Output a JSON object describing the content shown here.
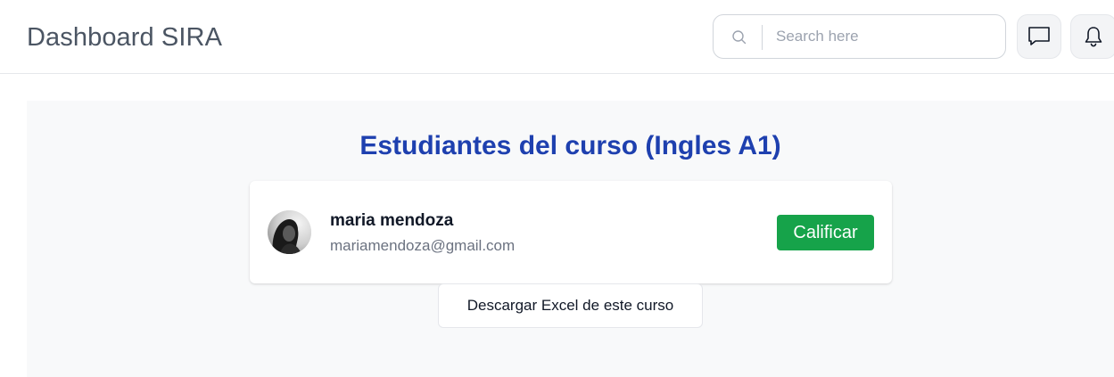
{
  "header": {
    "app_title": "Dashboard SIRA",
    "search": {
      "placeholder": "Search here",
      "value": "",
      "icon": "search-icon"
    },
    "buttons": [
      {
        "name": "messages",
        "icon": "chat-icon"
      },
      {
        "name": "notifications",
        "icon": "bell-icon"
      }
    ]
  },
  "main": {
    "heading": "Estudiantes del curso (Ingles A1)",
    "heading_color": "#1e40af",
    "students": [
      {
        "name": "maria mendoza",
        "email": "mariamendoza@gmail.com",
        "avatar": "avatar-photo",
        "action_label": "Calificar"
      }
    ],
    "download_label": "Descargar Excel de este curso"
  },
  "colors": {
    "accent": "#1e40af",
    "success": "#16a34a",
    "panel_bg": "#f8f9fa",
    "title_text": "#4b5563"
  }
}
